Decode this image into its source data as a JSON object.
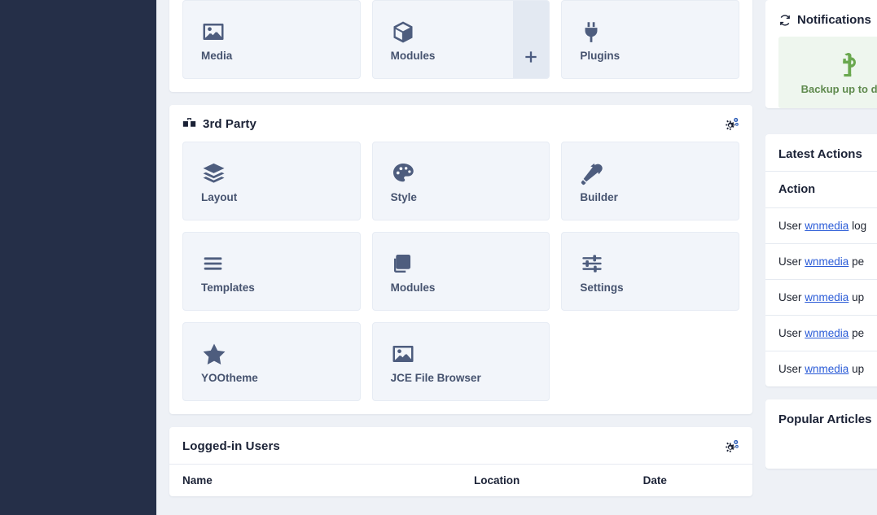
{
  "theme": {
    "sidebar_bg": "#252f48",
    "page_bg": "#eef1f6",
    "card_bg": "#ffffff",
    "tile_bg": "#f2f5fa",
    "icon_color": "#4e5d7e",
    "heading_color": "#1b2236",
    "link_color": "#2a5bd7",
    "notice_bg": "#eef6ee",
    "notice_text": "#5f8a4e",
    "add_bg": "#e3e9f2"
  },
  "quick_icons": {
    "tiles": [
      {
        "label": "Media",
        "icon": "image-icon",
        "has_add": false
      },
      {
        "label": "Modules",
        "icon": "cube-icon",
        "has_add": true,
        "add_label": "+"
      },
      {
        "label": "Plugins",
        "icon": "plug-icon",
        "has_add": false
      }
    ]
  },
  "third_party": {
    "title": "3rd Party",
    "header_icon": "boxes-icon",
    "options_icon": "cogs-icon",
    "tiles": [
      {
        "label": "Layout",
        "icon": "layers-icon"
      },
      {
        "label": "Style",
        "icon": "palette-icon"
      },
      {
        "label": "Builder",
        "icon": "hammer-icon"
      },
      {
        "label": "Templates",
        "icon": "bars-icon"
      },
      {
        "label": "Modules",
        "icon": "copy-icon"
      },
      {
        "label": "Settings",
        "icon": "sliders-icon"
      },
      {
        "label": "YOOtheme",
        "icon": "star-icon"
      },
      {
        "label": "JCE File Browser",
        "icon": "image-icon"
      }
    ]
  },
  "logged_in_users": {
    "title": "Logged-in Users",
    "options_icon": "cogs-icon",
    "columns": [
      "Name",
      "Location",
      "Date"
    ]
  },
  "notifications": {
    "title": "Notifications",
    "header_icon": "sync-icon",
    "item": {
      "icon": "joomla-logo-icon",
      "text": "Backup up to date"
    }
  },
  "latest_actions": {
    "title": "Latest Actions",
    "column": "Action",
    "rows": [
      {
        "prefix": "User",
        "user": "wnmedia",
        "suffix": "log"
      },
      {
        "prefix": "User",
        "user": "wnmedia",
        "suffix": "pe"
      },
      {
        "prefix": "User",
        "user": "wnmedia",
        "suffix": "up"
      },
      {
        "prefix": "User",
        "user": "wnmedia",
        "suffix": "pe"
      },
      {
        "prefix": "User",
        "user": "wnmedia",
        "suffix": "up"
      }
    ]
  },
  "popular_articles": {
    "title": "Popular Articles"
  }
}
